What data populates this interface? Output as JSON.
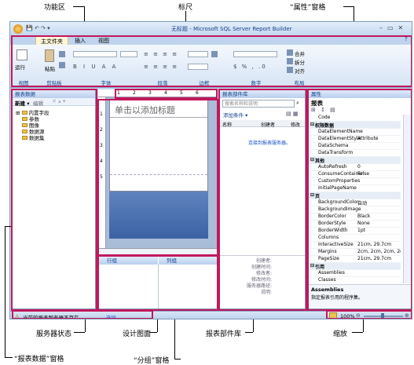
{
  "callouts": {
    "ribbon": "功能区",
    "ruler": "标尺",
    "properties_pane": "“属性”窗格",
    "server_status": "服务器状态",
    "design_surface": "设计图面",
    "report_part_gallery": "报表部件库",
    "zoom": "缩放",
    "report_data_pane": "“报表数据”窗格",
    "grouping_pane": "“分组”窗格"
  },
  "window": {
    "title": "无标题 - Microsoft SQL Server Report Builder",
    "controls": [
      "–",
      "▭",
      "✕"
    ]
  },
  "tabs": [
    "主文件夹",
    "插入",
    "视图"
  ],
  "active_tab": 0,
  "ribbon_groups": [
    "视图",
    "剪贴板",
    "字体",
    "段落",
    "边框",
    "数字",
    "布局"
  ],
  "ribbon_buttons": {
    "run": "运行",
    "paste": "粘贴",
    "merge": "合并",
    "split": "拆分",
    "align": "对齐"
  },
  "report_data": {
    "title": "报表数据",
    "toolbar_new": "新建 ▾",
    "toolbar_edit": "编辑",
    "items": [
      "内置字段",
      "参数",
      "图像",
      "数据源",
      "数据集"
    ]
  },
  "design": {
    "ruler_ticks": [
      "1",
      "2",
      "3",
      "4",
      "5",
      "6"
    ],
    "title_placeholder": "单击以添加标题",
    "ruler_left": [
      "1",
      "2",
      "3",
      "4",
      "5"
    ]
  },
  "grouping": {
    "row_groups": "行组",
    "column_groups": "列组"
  },
  "gallery": {
    "title": "报表部件库",
    "search_placeholder": "搜索名称和说明",
    "add_criteria": "添加条件 ▾",
    "columns": [
      "名称",
      "创建者",
      "修改"
    ],
    "link": "连接到报表服务器。",
    "details": [
      "创建者:",
      "创建时间:",
      "修改者:",
      "修改时间:",
      "服务器路径:",
      "说明:"
    ]
  },
  "properties": {
    "title": "属性",
    "object": "报表",
    "rows": [
      {
        "k": "Code",
        "v": "",
        "cat": false
      },
      {
        "k": "权限数据",
        "v": "",
        "cat": true
      },
      {
        "k": "DataElementName",
        "v": "",
        "cat": false
      },
      {
        "k": "DataElementStyle",
        "v": "Attribute",
        "cat": false
      },
      {
        "k": "DataSchema",
        "v": "",
        "cat": false
      },
      {
        "k": "DataTransform",
        "v": "",
        "cat": false
      },
      {
        "k": "其他",
        "v": "",
        "cat": true
      },
      {
        "k": "AutoRefresh",
        "v": "0",
        "cat": false
      },
      {
        "k": "ConsumeContainer",
        "v": "False",
        "cat": false
      },
      {
        "k": "CustomProperties",
        "v": "",
        "cat": false
      },
      {
        "k": "InitialPageName",
        "v": "",
        "cat": false
      },
      {
        "k": "页",
        "v": "",
        "cat": true
      },
      {
        "k": "BackgroundColor",
        "v": "自动",
        "cat": false
      },
      {
        "k": "BackgroundImage",
        "v": "",
        "cat": false
      },
      {
        "k": "BorderColor",
        "v": "Black",
        "cat": false
      },
      {
        "k": "BorderStyle",
        "v": "None",
        "cat": false
      },
      {
        "k": "BorderWidth",
        "v": "1pt",
        "cat": false
      },
      {
        "k": "Columns",
        "v": "",
        "cat": false
      },
      {
        "k": "InteractiveSize",
        "v": "21cm, 29.7cm",
        "cat": false
      },
      {
        "k": "Margins",
        "v": "2cm, 2cm, 2cm, 2cm",
        "cat": false
      },
      {
        "k": "PageSize",
        "v": "21cm, 29.7cm",
        "cat": false
      },
      {
        "k": "引用",
        "v": "",
        "cat": true
      },
      {
        "k": "Assemblies",
        "v": "",
        "cat": false
      },
      {
        "k": "Classes",
        "v": "",
        "cat": false
      }
    ],
    "desc_title": "Assemblies",
    "desc_text": "指定报表引用的程序集。"
  },
  "status": {
    "server_text": "当前的报表服务器不存在。",
    "connect": "连接",
    "zoom": "100%"
  }
}
